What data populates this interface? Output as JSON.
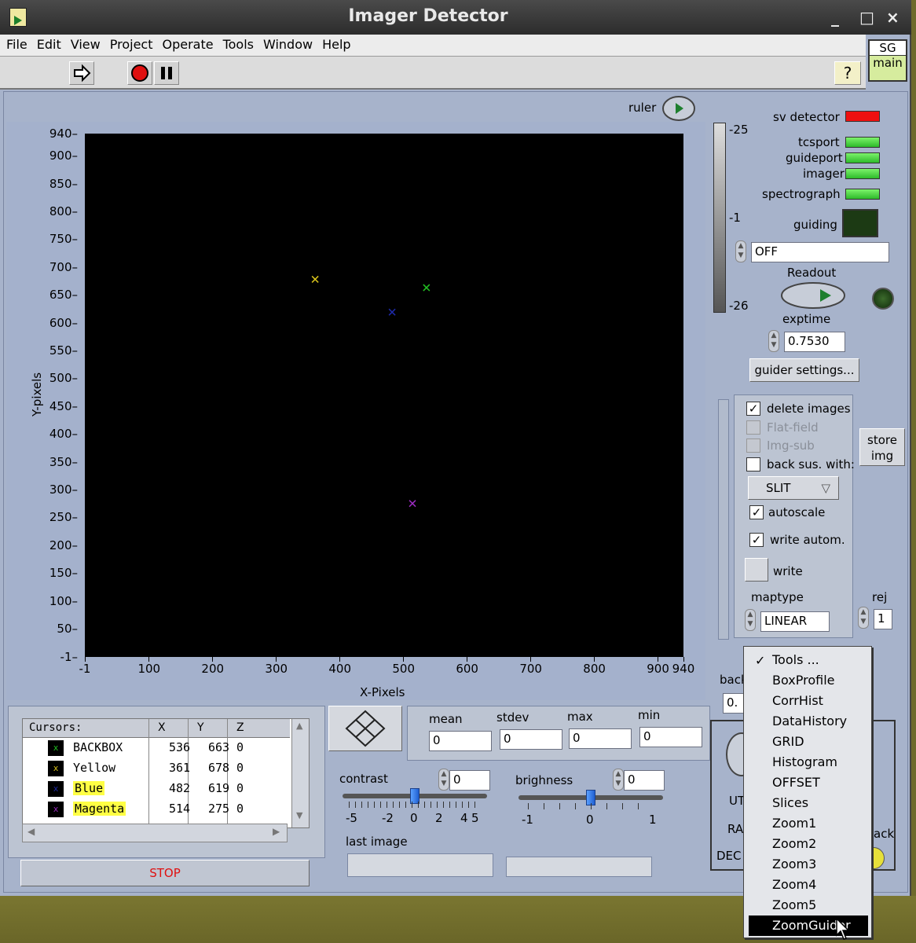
{
  "window": {
    "title": "Imager Detector",
    "controls": [
      "_",
      "□",
      "×"
    ]
  },
  "menu": [
    "File",
    "Edit",
    "View",
    "Project",
    "Operate",
    "Tools",
    "Window",
    "Help"
  ],
  "sg": {
    "top": "SG",
    "bottom": "main"
  },
  "toolbar": {
    "help": "?"
  },
  "ruler_label": "ruler",
  "plot": {
    "xlabel": "X-Pixels",
    "ylabel": "Y-pixels",
    "xticks": [
      "-1",
      "100",
      "200",
      "300",
      "400",
      "500",
      "600",
      "700",
      "800",
      "900",
      "940"
    ],
    "yticks": [
      "940",
      "900",
      "850",
      "800",
      "750",
      "700",
      "650",
      "600",
      "550",
      "500",
      "450",
      "400",
      "350",
      "300",
      "250",
      "200",
      "150",
      "100",
      "50",
      "-1"
    ]
  },
  "chart_data": {
    "type": "scatter",
    "title": "",
    "xlabel": "X-Pixels",
    "ylabel": "Y-pixels",
    "xlim": [
      -1,
      940
    ],
    "ylim": [
      -1,
      940
    ],
    "grid": false,
    "points": [
      {
        "x": 536,
        "y": 663,
        "color": "#22c022"
      },
      {
        "x": 361,
        "y": 678,
        "color": "#d8c21a"
      },
      {
        "x": 482,
        "y": 619,
        "color": "#1e2aa8"
      },
      {
        "x": 514,
        "y": 275,
        "color": "#9a2bc0"
      }
    ]
  },
  "colorbar": {
    "top": "-25",
    "mid": "-1",
    "bottom": "-26"
  },
  "status": {
    "sv_detector": "sv detector",
    "tcsport": "tcsport",
    "guideport": "guideport",
    "imager": "imager",
    "spectrograph": "spectrograph",
    "guiding": "guiding",
    "colors": {
      "red": "#ee1010",
      "green": "#3fd83a",
      "dark": "#1c3a14"
    }
  },
  "guide_mode": "OFF",
  "readout_label": "Readout",
  "exptime_label": "exptime",
  "exptime_value": "0.7530",
  "guider_settings": "guider settings...",
  "options": {
    "delete_images": "delete images",
    "flat_field": "Flat-field",
    "img_sub": "Img-sub",
    "back_sus": "back sus. with:",
    "slit": "SLIT",
    "autoscale": "autoscale",
    "write_autom": "write autom.",
    "write": "write",
    "maptype_label": "maptype",
    "maptype_value": "LINEAR",
    "rej_label": "rej",
    "rej_value": "1"
  },
  "store_img": {
    "line1": "store",
    "line2": "img"
  },
  "cursors": {
    "header": "Cursors:",
    "columns": [
      "X",
      "Y",
      "Z"
    ],
    "rows": [
      {
        "name": "BACKBOX",
        "x": "536",
        "y": "663",
        "z": "0"
      },
      {
        "name": "Yellow",
        "x": "361",
        "y": "678",
        "z": "0"
      },
      {
        "name": "Blue",
        "x": "482",
        "y": "619",
        "z": "0"
      },
      {
        "name": "Magenta",
        "x": "514",
        "y": "275",
        "z": "0"
      }
    ]
  },
  "stop": "STOP",
  "stats": {
    "mean_label": "mean",
    "mean": "0",
    "stdev_label": "stdev",
    "stdev": "0",
    "max_label": "max",
    "max": "0",
    "min_label": "min",
    "min": "0"
  },
  "contrast": {
    "label": "contrast",
    "value": "0",
    "scale": [
      "-5",
      "-2",
      "0",
      "2",
      "4",
      "5"
    ],
    "level": 0
  },
  "brightness": {
    "label": "brighness",
    "value": "0",
    "scale": [
      "-1",
      "0",
      "1"
    ],
    "level": 0
  },
  "last_image_label": "last image",
  "partial_labels": {
    "back": "back",
    "value": "0.",
    "ut": "UT",
    "ra": "RA",
    "dec": "DEC",
    "ack": "ack"
  },
  "tools_menu": {
    "items": [
      "Tools ...",
      "BoxProfile",
      "CorrHist",
      "DataHistory",
      "GRID",
      "Histogram",
      "OFFSET",
      "Slices",
      "Zoom1",
      "Zoom2",
      "Zoom3",
      "Zoom4",
      "Zoom5",
      "ZoomGuider"
    ],
    "checked": "Tools ...",
    "highlighted": "ZoomGuider"
  }
}
